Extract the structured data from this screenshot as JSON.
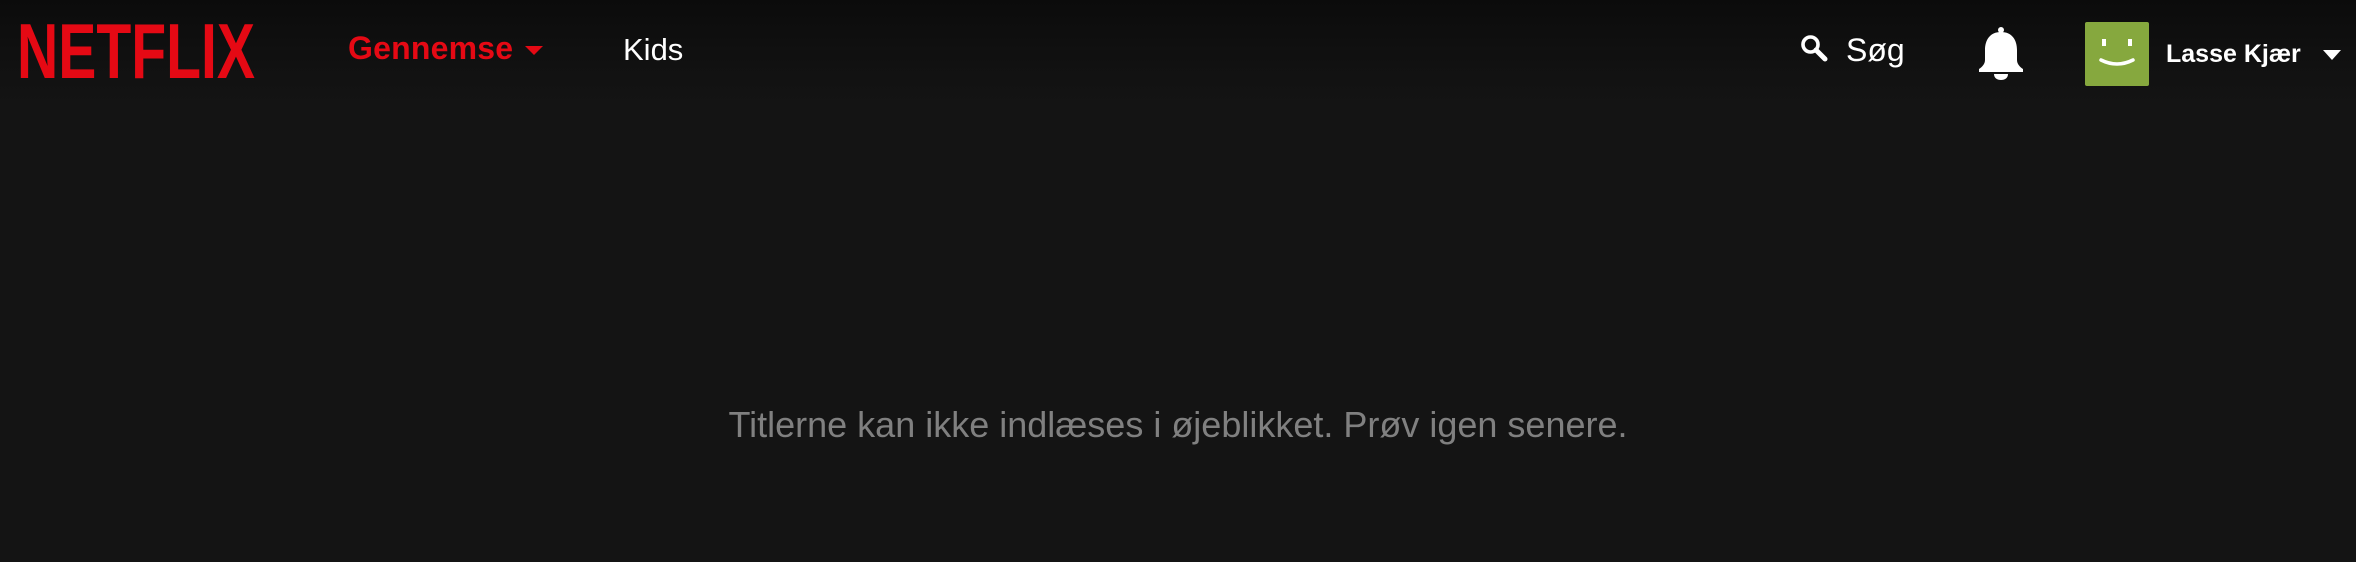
{
  "brand": {
    "logo_text": "NETFLIX",
    "accent_color": "#e50914"
  },
  "nav": {
    "browse_label": "Gennemse",
    "kids_label": "Kids"
  },
  "search": {
    "label": "Søg",
    "icon": "search-icon"
  },
  "notifications": {
    "icon": "bell-icon"
  },
  "profile": {
    "name": "Lasse Kjær",
    "avatar_color": "#86a83e",
    "avatar_icon": "smiley-face-icon"
  },
  "main": {
    "message": "Titlerne kan ikke indlæses i øjeblikket. Prøv igen senere."
  },
  "colors": {
    "background": "#141414",
    "message_text": "#808080"
  }
}
